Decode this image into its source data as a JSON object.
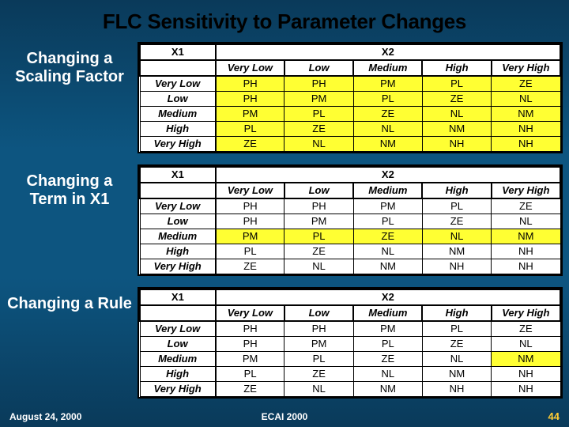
{
  "title": "FLC Sensitivity to Parameter Changes",
  "footer": {
    "date": "August 24, 2000",
    "venue": "ECAI 2000",
    "page": "44"
  },
  "axes": {
    "x1": "X1",
    "x2": "X2"
  },
  "column_labels": [
    "Very Low",
    "Low",
    "Medium",
    "High",
    "Very High"
  ],
  "row_labels": [
    "Very Low",
    "Low",
    "Medium",
    "High",
    "Very High"
  ],
  "panels": [
    {
      "label": "Changing a Scaling Factor",
      "cells": [
        [
          "PH",
          "PH",
          "PM",
          "PL",
          "ZE"
        ],
        [
          "PH",
          "PM",
          "PL",
          "ZE",
          "NL"
        ],
        [
          "PM",
          "PL",
          "ZE",
          "NL",
          "NM"
        ],
        [
          "PL",
          "ZE",
          "NL",
          "NM",
          "NH"
        ],
        [
          "ZE",
          "NL",
          "NM",
          "NH",
          "NH"
        ]
      ],
      "highlight": {
        "rows": [
          0,
          1,
          2,
          3,
          4
        ],
        "cols": [
          0,
          1,
          2,
          3,
          4
        ]
      }
    },
    {
      "label": "Changing a Term in X1",
      "cells": [
        [
          "PH",
          "PH",
          "PM",
          "PL",
          "ZE"
        ],
        [
          "PH",
          "PM",
          "PL",
          "ZE",
          "NL"
        ],
        [
          "PM",
          "PL",
          "ZE",
          "NL",
          "NM"
        ],
        [
          "PL",
          "ZE",
          "NL",
          "NM",
          "NH"
        ],
        [
          "ZE",
          "NL",
          "NM",
          "NH",
          "NH"
        ]
      ],
      "highlight": {
        "rows": [
          2
        ],
        "cols": [
          0,
          1,
          2,
          3,
          4
        ]
      }
    },
    {
      "label": "Changing a Rule",
      "cells": [
        [
          "PH",
          "PH",
          "PM",
          "PL",
          "ZE"
        ],
        [
          "PH",
          "PM",
          "PL",
          "ZE",
          "NL"
        ],
        [
          "PM",
          "PL",
          "ZE",
          "NL",
          "NM"
        ],
        [
          "PL",
          "ZE",
          "NL",
          "NM",
          "NH"
        ],
        [
          "ZE",
          "NL",
          "NM",
          "NH",
          "NH"
        ]
      ],
      "highlight": {
        "rows": [
          2
        ],
        "cols": [
          4
        ]
      }
    }
  ]
}
